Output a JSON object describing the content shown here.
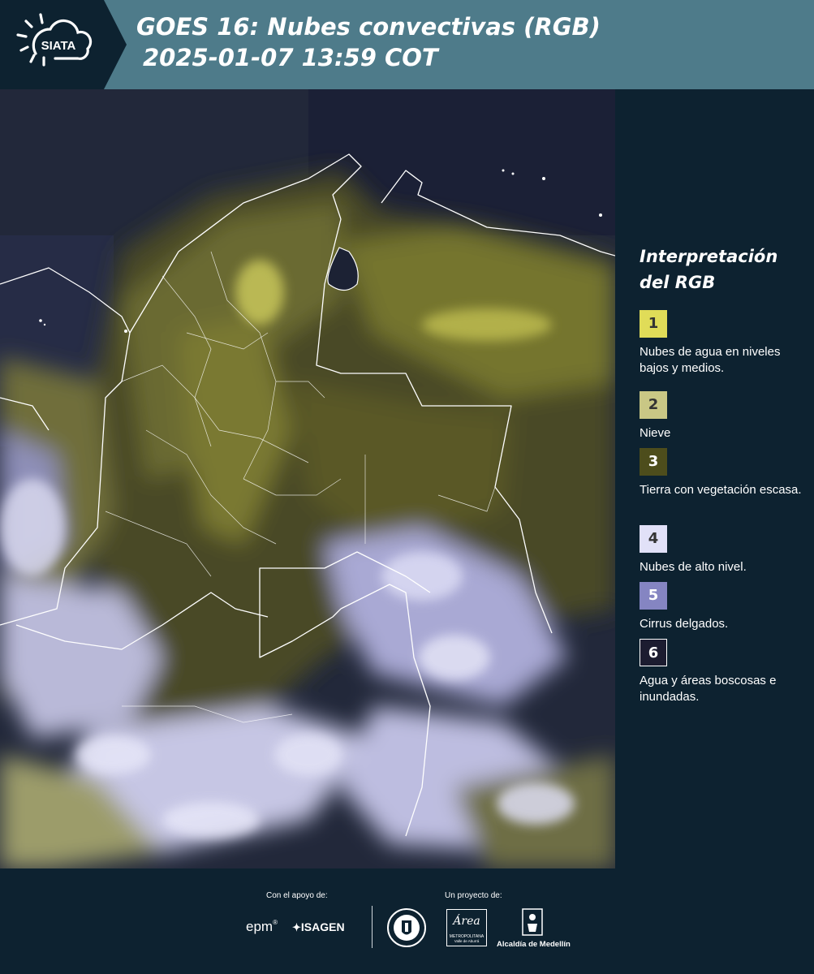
{
  "header": {
    "logo_text": "SIATA",
    "title_line1": "GOES 16: Nubes convectivas (RGB)",
    "title_line2": "2025-01-07 13:59 COT"
  },
  "legend": {
    "title_line1": "Interpretación",
    "title_line2": "del RGB",
    "items": [
      {
        "number": "1",
        "label": "Nubes de agua en niveles bajos y medios.",
        "color": "#e0dc58"
      },
      {
        "number": "2",
        "label": "Nieve",
        "color": "#c9c785"
      },
      {
        "number": "3",
        "label": "Tierra con vegetación escasa.",
        "color": "#4d4d1c"
      },
      {
        "number": "4",
        "label": "Nubes de alto nivel.",
        "color": "#e1e1f8"
      },
      {
        "number": "5",
        "label": "Cirrus delgados.",
        "color": "#8585c2"
      },
      {
        "number": "6",
        "label": "Agua y áreas boscosas e inundadas.",
        "color": "#1c1c30"
      }
    ]
  },
  "footer": {
    "support_label": "Con el apoyo de:",
    "project_label": "Un proyecto de:",
    "epm": "epm",
    "isagen": "ISAGEN",
    "metropolitana": "METROPOLITANA",
    "valle": "Valle de Aburrá",
    "area": "Área",
    "alcaldia": "Alcaldía de Medellín"
  }
}
